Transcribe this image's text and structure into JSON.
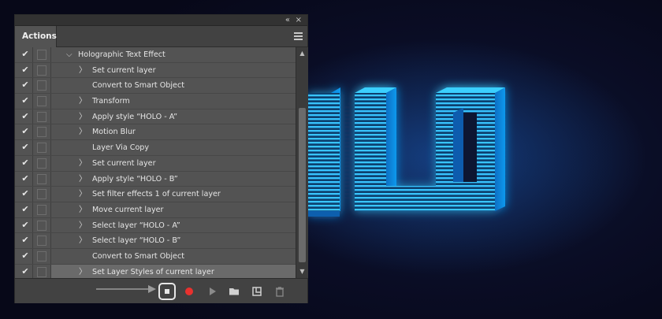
{
  "panel": {
    "tab_label": "Actions",
    "collapse_glyph": "«",
    "close_glyph": "×"
  },
  "actions": [
    {
      "label": "Holographic Text Effect",
      "checked": true,
      "indent": 0,
      "expander": "chevron-down-icon",
      "selected": false
    },
    {
      "label": "Set current layer",
      "checked": true,
      "indent": 1,
      "expander": "chevron-right-icon",
      "selected": false
    },
    {
      "label": "Convert to Smart Object",
      "checked": true,
      "indent": 1,
      "expander": "",
      "selected": false
    },
    {
      "label": "Transform",
      "checked": true,
      "indent": 1,
      "expander": "chevron-right-icon",
      "selected": false
    },
    {
      "label": "Apply style “HOLO  - A”",
      "checked": true,
      "indent": 1,
      "expander": "chevron-right-icon",
      "selected": false
    },
    {
      "label": "Motion Blur",
      "checked": true,
      "indent": 1,
      "expander": "chevron-right-icon",
      "selected": false
    },
    {
      "label": "Layer Via Copy",
      "checked": true,
      "indent": 1,
      "expander": "",
      "selected": false
    },
    {
      "label": "Set current layer",
      "checked": true,
      "indent": 1,
      "expander": "chevron-right-icon",
      "selected": false
    },
    {
      "label": "Apply style “HOLO - B”",
      "checked": true,
      "indent": 1,
      "expander": "chevron-right-icon",
      "selected": false
    },
    {
      "label": "Set filter effects 1 of current layer",
      "checked": true,
      "indent": 1,
      "expander": "chevron-right-icon",
      "selected": false
    },
    {
      "label": "Move current layer",
      "checked": true,
      "indent": 1,
      "expander": "chevron-right-icon",
      "selected": false
    },
    {
      "label": "Select layer “HOLO - A”",
      "checked": true,
      "indent": 1,
      "expander": "chevron-right-icon",
      "selected": false
    },
    {
      "label": "Select layer “HOLO - B”",
      "checked": true,
      "indent": 1,
      "expander": "chevron-right-icon",
      "selected": false
    },
    {
      "label": "Convert to Smart Object",
      "checked": true,
      "indent": 1,
      "expander": "",
      "selected": false
    },
    {
      "label": "Set Layer Styles of current layer",
      "checked": true,
      "indent": 1,
      "expander": "chevron-right-icon",
      "selected": true
    }
  ],
  "toolbar": {
    "buttons": [
      "stop-icon",
      "record-icon",
      "play-icon",
      "folder-icon",
      "new-action-icon",
      "trash-icon"
    ]
  },
  "colors": {
    "panel_bg": "#535353",
    "record_red": "#e8312e",
    "neon_blue": "#1aa8ff"
  }
}
